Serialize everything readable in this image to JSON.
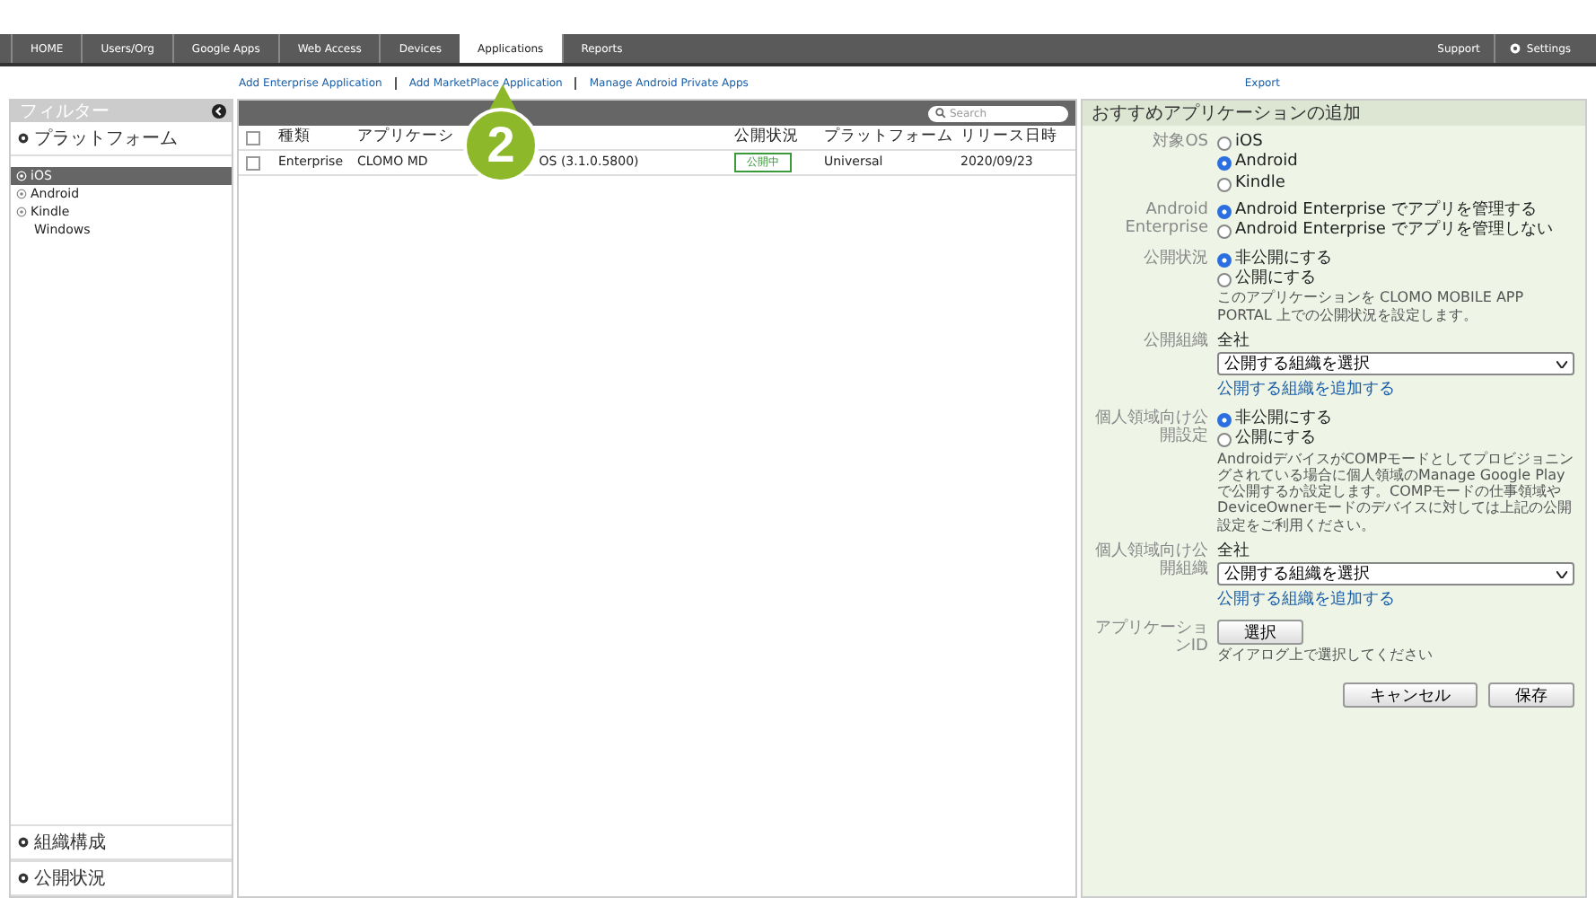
{
  "nav": {
    "tabs": [
      {
        "label": "HOME",
        "selected": false
      },
      {
        "label": "Users/Org",
        "selected": false
      },
      {
        "label": "Google Apps",
        "selected": false
      },
      {
        "label": "Web Access",
        "selected": false
      },
      {
        "label": "Devices",
        "selected": false
      },
      {
        "label": "Applications",
        "selected": true
      },
      {
        "label": "Reports",
        "selected": false
      }
    ],
    "right": [
      {
        "label": "Support",
        "kind": "link"
      },
      {
        "label": "Settings",
        "kind": "settings"
      }
    ]
  },
  "actions": {
    "links": [
      "Add Enterprise Application",
      "Add MarketPlace Application",
      "Manage Android Private Apps"
    ],
    "export": "Export"
  },
  "filter": {
    "title": "フィルター",
    "section": "プラットフォーム",
    "items": [
      {
        "label": "iOS",
        "selected": true,
        "kind": "radio"
      },
      {
        "label": "Android",
        "selected": false,
        "kind": "radio"
      },
      {
        "label": "Kindle",
        "selected": false,
        "kind": "radio"
      },
      {
        "label": "Windows",
        "kind": "plain"
      }
    ],
    "bottom": [
      "組織構成",
      "公開状況"
    ]
  },
  "table": {
    "search": {
      "placeholder": "Search"
    },
    "all_checked": false,
    "columns": [
      "種類",
      "アプリケーシ",
      "公開状況",
      "プラットフォーム",
      "リリース日時"
    ],
    "rows": [
      {
        "checked": false,
        "type": "Enterprise",
        "name_parts": [
          "CLOMO MD",
          "OS (3.1.0.5800)"
        ],
        "status": "公開中",
        "platform": "Universal",
        "date": "2020/09/23"
      }
    ]
  },
  "callout": {
    "text": "2"
  },
  "panel": {
    "title": "おすすめアプリケーションの追加",
    "fields": [
      {
        "label": "対象OS",
        "kind": "radios",
        "options": [
          {
            "label": "iOS",
            "selected": false
          },
          {
            "label": "Android",
            "selected": true
          },
          {
            "label": "Kindle",
            "selected": false
          }
        ]
      },
      {
        "label": "Android Enterprise",
        "kind": "radios",
        "options": [
          {
            "label": "Android Enterprise でアプリを管理する",
            "selected": true
          },
          {
            "label": "Android Enterprise でアプリを管理しない",
            "selected": false
          }
        ]
      },
      {
        "label": "公開状況",
        "kind": "radios",
        "options": [
          {
            "label": "非公開にする",
            "selected": true
          },
          {
            "label": "公開にする",
            "selected": false
          }
        ],
        "note": "このアプリケーションを CLOMO MOBILE APP PORTAL 上での公開状況を設定します。"
      },
      {
        "label": "公開組織",
        "kind": "select",
        "value": "全社",
        "select": "公開する組織を選択",
        "link": "公開する組織を追加する"
      },
      {
        "label": "個人領域向け公開設定",
        "kind": "radios",
        "options": [
          {
            "label": "非公開にする",
            "selected": true
          },
          {
            "label": "公開にする",
            "selected": false
          }
        ],
        "note": "AndroidデバイスがCOMPモードとしてプロビジョニングされている場合に個人領域のManage Google Playで公開するか設定します。COMPモードの仕事領域やDeviceOwnerモードのデバイスに対しては上記の公開設定をご利用ください。"
      },
      {
        "label": "個人領域向け公開組織",
        "kind": "select",
        "value": "全社",
        "select": "公開する組織を選択",
        "link": "公開する組織を追加する"
      },
      {
        "label": "アプリケーションID",
        "kind": "button",
        "button": "選択",
        "note": "ダイアログ上で選択してください"
      }
    ],
    "buttons": [
      "キャンセル",
      "保存"
    ]
  }
}
